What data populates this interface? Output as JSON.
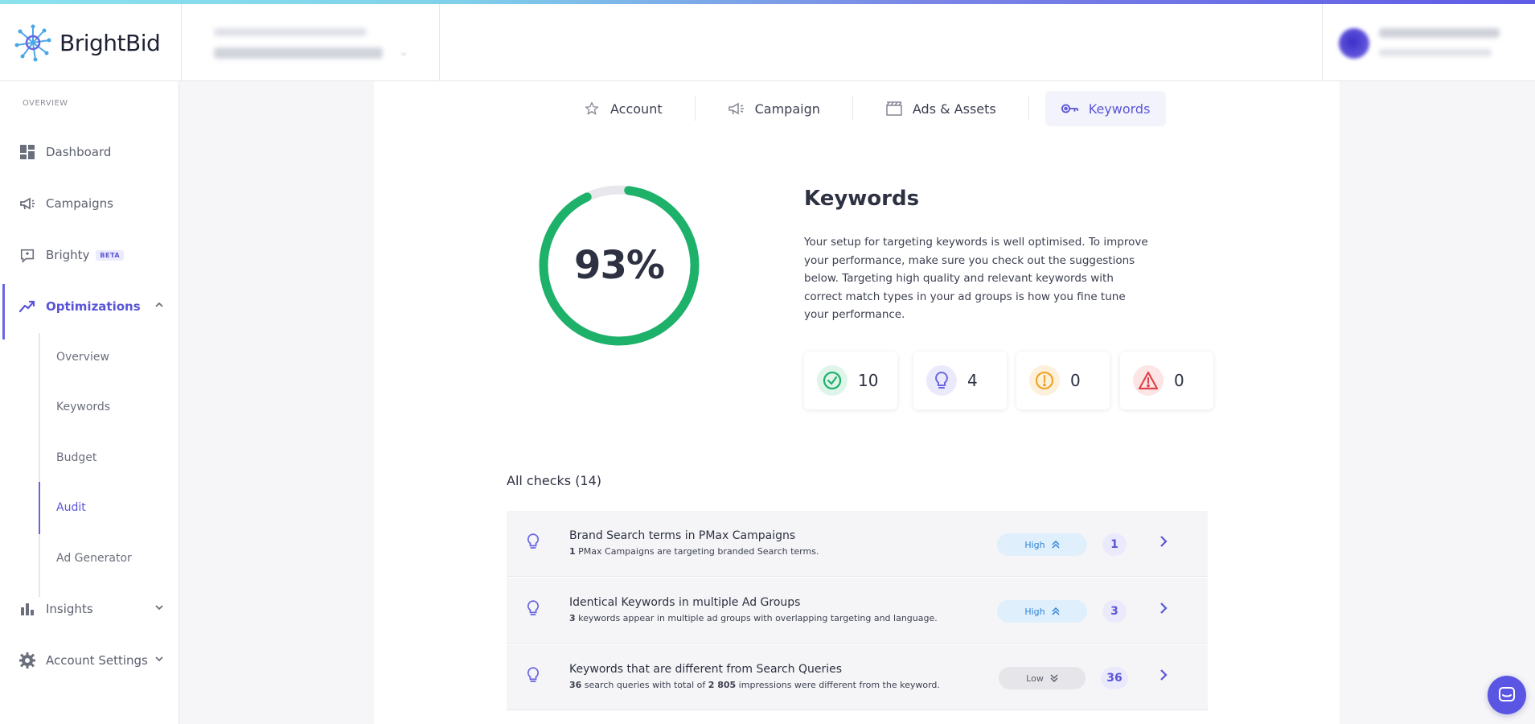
{
  "app": {
    "name": "BrightBid"
  },
  "sidebar": {
    "section_label": "OVERVIEW",
    "items": [
      {
        "label": "Dashboard",
        "icon": "dashboard-icon"
      },
      {
        "label": "Campaigns",
        "icon": "megaphone-icon"
      },
      {
        "label": "Brighty",
        "icon": "brighty-icon",
        "badge": "BETA"
      },
      {
        "label": "Optimizations",
        "icon": "trend-icon",
        "active": true
      },
      {
        "label": "Insights",
        "icon": "bar-chart-icon"
      },
      {
        "label": "Account Settings",
        "icon": "gear-icon"
      }
    ],
    "sub_items": [
      {
        "label": "Overview"
      },
      {
        "label": "Keywords"
      },
      {
        "label": "Budget"
      },
      {
        "label": "Audit",
        "active": true
      },
      {
        "label": "Ad Generator"
      }
    ]
  },
  "tabs": [
    {
      "label": "Account",
      "icon": "star-icon"
    },
    {
      "label": "Campaign",
      "icon": "megaphone-icon"
    },
    {
      "label": "Ads & Assets",
      "icon": "clapper-icon"
    },
    {
      "label": "Keywords",
      "icon": "key-icon",
      "active": true
    }
  ],
  "score": {
    "value": 93,
    "label": "93%"
  },
  "section": {
    "title": "Keywords",
    "description": "Your setup for targeting keywords is well optimised. To improve your performance, make sure you check out the suggestions below. Targeting high quality and relevant keywords with correct match types in your ad groups is how you fine tune your performance."
  },
  "stats": [
    {
      "type": "passed",
      "icon": "check-circle-icon",
      "count": "10",
      "color": "#1db16a"
    },
    {
      "type": "suggestion",
      "icon": "lightbulb-icon",
      "count": "4",
      "color": "#6a64e3"
    },
    {
      "type": "warning",
      "icon": "exclamation-circle-icon",
      "count": "0",
      "color": "#f0a429"
    },
    {
      "type": "critical",
      "icon": "alert-triangle-icon",
      "count": "0",
      "color": "#e0454a"
    }
  ],
  "checks": {
    "heading": "All checks (14)",
    "rows": [
      {
        "title": "Brand Search terms in PMax Campaigns",
        "sub_bold": "1",
        "sub_rest": " PMax Campaigns are targeting branded Search terms.",
        "priority": "High",
        "count": "1"
      },
      {
        "title": "Identical Keywords in multiple Ad Groups",
        "sub_bold": "3",
        "sub_rest": " keywords appear in multiple ad groups with overlapping targeting and language.",
        "priority": "High",
        "count": "3"
      },
      {
        "title": "Keywords that are different from Search Queries",
        "sub_bold": "36",
        "sub_mid": " search queries with total of ",
        "sub_bold2": "2 805",
        "sub_rest": " impressions were different from the keyword.",
        "priority": "Low",
        "count": "36"
      }
    ]
  },
  "colors": {
    "accent": "#5a55d8",
    "success": "#1db16a",
    "high_badge": "#2f84d8"
  }
}
